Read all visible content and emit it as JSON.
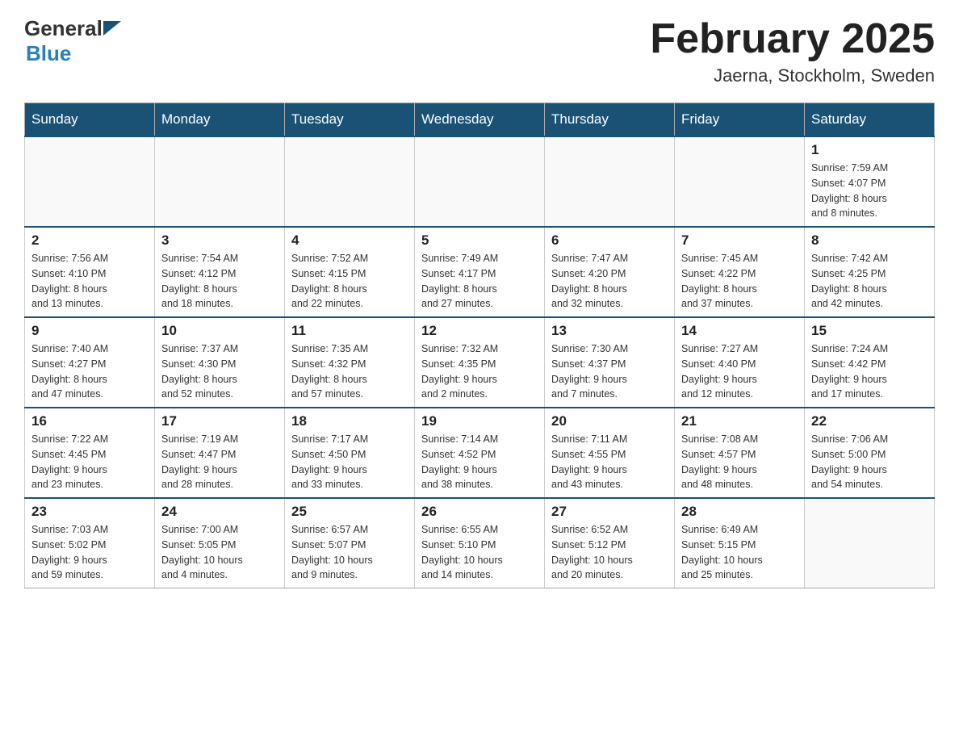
{
  "header": {
    "logo_general": "General",
    "logo_blue": "Blue",
    "title": "February 2025",
    "subtitle": "Jaerna, Stockholm, Sweden"
  },
  "weekdays": [
    "Sunday",
    "Monday",
    "Tuesday",
    "Wednesday",
    "Thursday",
    "Friday",
    "Saturday"
  ],
  "weeks": [
    [
      {
        "num": "",
        "info": ""
      },
      {
        "num": "",
        "info": ""
      },
      {
        "num": "",
        "info": ""
      },
      {
        "num": "",
        "info": ""
      },
      {
        "num": "",
        "info": ""
      },
      {
        "num": "",
        "info": ""
      },
      {
        "num": "1",
        "info": "Sunrise: 7:59 AM\nSunset: 4:07 PM\nDaylight: 8 hours\nand 8 minutes."
      }
    ],
    [
      {
        "num": "2",
        "info": "Sunrise: 7:56 AM\nSunset: 4:10 PM\nDaylight: 8 hours\nand 13 minutes."
      },
      {
        "num": "3",
        "info": "Sunrise: 7:54 AM\nSunset: 4:12 PM\nDaylight: 8 hours\nand 18 minutes."
      },
      {
        "num": "4",
        "info": "Sunrise: 7:52 AM\nSunset: 4:15 PM\nDaylight: 8 hours\nand 22 minutes."
      },
      {
        "num": "5",
        "info": "Sunrise: 7:49 AM\nSunset: 4:17 PM\nDaylight: 8 hours\nand 27 minutes."
      },
      {
        "num": "6",
        "info": "Sunrise: 7:47 AM\nSunset: 4:20 PM\nDaylight: 8 hours\nand 32 minutes."
      },
      {
        "num": "7",
        "info": "Sunrise: 7:45 AM\nSunset: 4:22 PM\nDaylight: 8 hours\nand 37 minutes."
      },
      {
        "num": "8",
        "info": "Sunrise: 7:42 AM\nSunset: 4:25 PM\nDaylight: 8 hours\nand 42 minutes."
      }
    ],
    [
      {
        "num": "9",
        "info": "Sunrise: 7:40 AM\nSunset: 4:27 PM\nDaylight: 8 hours\nand 47 minutes."
      },
      {
        "num": "10",
        "info": "Sunrise: 7:37 AM\nSunset: 4:30 PM\nDaylight: 8 hours\nand 52 minutes."
      },
      {
        "num": "11",
        "info": "Sunrise: 7:35 AM\nSunset: 4:32 PM\nDaylight: 8 hours\nand 57 minutes."
      },
      {
        "num": "12",
        "info": "Sunrise: 7:32 AM\nSunset: 4:35 PM\nDaylight: 9 hours\nand 2 minutes."
      },
      {
        "num": "13",
        "info": "Sunrise: 7:30 AM\nSunset: 4:37 PM\nDaylight: 9 hours\nand 7 minutes."
      },
      {
        "num": "14",
        "info": "Sunrise: 7:27 AM\nSunset: 4:40 PM\nDaylight: 9 hours\nand 12 minutes."
      },
      {
        "num": "15",
        "info": "Sunrise: 7:24 AM\nSunset: 4:42 PM\nDaylight: 9 hours\nand 17 minutes."
      }
    ],
    [
      {
        "num": "16",
        "info": "Sunrise: 7:22 AM\nSunset: 4:45 PM\nDaylight: 9 hours\nand 23 minutes."
      },
      {
        "num": "17",
        "info": "Sunrise: 7:19 AM\nSunset: 4:47 PM\nDaylight: 9 hours\nand 28 minutes."
      },
      {
        "num": "18",
        "info": "Sunrise: 7:17 AM\nSunset: 4:50 PM\nDaylight: 9 hours\nand 33 minutes."
      },
      {
        "num": "19",
        "info": "Sunrise: 7:14 AM\nSunset: 4:52 PM\nDaylight: 9 hours\nand 38 minutes."
      },
      {
        "num": "20",
        "info": "Sunrise: 7:11 AM\nSunset: 4:55 PM\nDaylight: 9 hours\nand 43 minutes."
      },
      {
        "num": "21",
        "info": "Sunrise: 7:08 AM\nSunset: 4:57 PM\nDaylight: 9 hours\nand 48 minutes."
      },
      {
        "num": "22",
        "info": "Sunrise: 7:06 AM\nSunset: 5:00 PM\nDaylight: 9 hours\nand 54 minutes."
      }
    ],
    [
      {
        "num": "23",
        "info": "Sunrise: 7:03 AM\nSunset: 5:02 PM\nDaylight: 9 hours\nand 59 minutes."
      },
      {
        "num": "24",
        "info": "Sunrise: 7:00 AM\nSunset: 5:05 PM\nDaylight: 10 hours\nand 4 minutes."
      },
      {
        "num": "25",
        "info": "Sunrise: 6:57 AM\nSunset: 5:07 PM\nDaylight: 10 hours\nand 9 minutes."
      },
      {
        "num": "26",
        "info": "Sunrise: 6:55 AM\nSunset: 5:10 PM\nDaylight: 10 hours\nand 14 minutes."
      },
      {
        "num": "27",
        "info": "Sunrise: 6:52 AM\nSunset: 5:12 PM\nDaylight: 10 hours\nand 20 minutes."
      },
      {
        "num": "28",
        "info": "Sunrise: 6:49 AM\nSunset: 5:15 PM\nDaylight: 10 hours\nand 25 minutes."
      },
      {
        "num": "",
        "info": ""
      }
    ]
  ]
}
